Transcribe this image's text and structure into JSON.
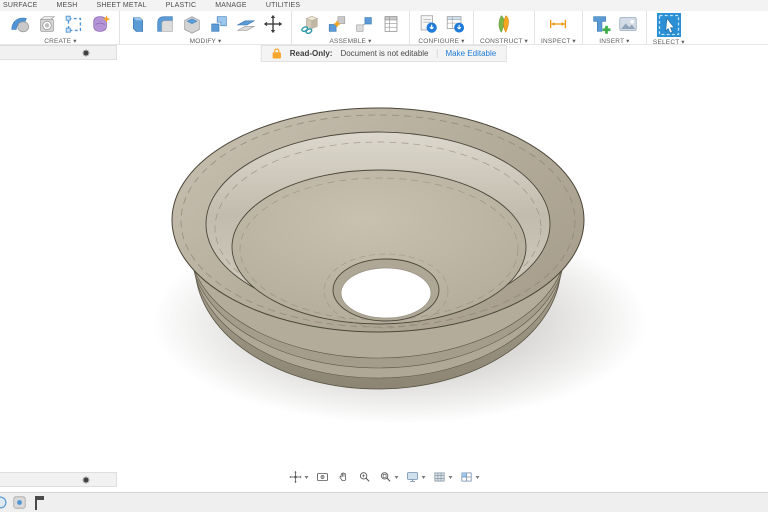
{
  "ribbon": {
    "tabs": [
      "SURFACE",
      "MESH",
      "SHEET METAL",
      "PLASTIC",
      "MANAGE",
      "UTILITIES"
    ],
    "groups": [
      {
        "label": "CREATE ▾",
        "icons": [
          "sweep-icon",
          "hole-face-icon",
          "sketch-icon",
          "form-icon"
        ]
      },
      {
        "label": "MODIFY ▾",
        "icons": [
          "press-pull-icon",
          "fillet-icon",
          "shell-icon",
          "combine-icon",
          "offset-face-icon",
          "move-icon"
        ]
      },
      {
        "label": "ASSEMBLE ▾",
        "icons": [
          "new-component-icon",
          "joint-icon",
          "as-built-joint-icon",
          "bom-table-icon"
        ]
      },
      {
        "label": "CONFIGURE ▾",
        "icons": [
          "configuration-icon",
          "configuration-table-icon"
        ]
      },
      {
        "label": "CONSTRUCT ▾",
        "icons": [
          "construction-plane-icon"
        ]
      },
      {
        "label": "INSPECT ▾",
        "icons": [
          "measure-icon"
        ]
      },
      {
        "label": "INSERT ▾",
        "icons": [
          "insert-derive-icon",
          "insert-image-icon"
        ]
      },
      {
        "label": "SELECT ▾",
        "icons": [
          "select-cursor-icon"
        ]
      }
    ]
  },
  "banner": {
    "title": "Read-Only:",
    "message": "Document is not editable",
    "action": "Make Editable",
    "lock_icon": "lock-icon",
    "colors": {
      "lock": "#f7a82a",
      "action_link": "#1e7bd7"
    }
  },
  "panels": {
    "top_collapsed_bar_icon": "gear-icon",
    "bottom_collapsed_bar_icon": "gear-icon"
  },
  "view_toolbar": {
    "items": [
      {
        "name": "orbit-icon",
        "dropdown": true
      },
      {
        "name": "look-at-icon",
        "dropdown": false
      },
      {
        "name": "pan-icon",
        "dropdown": false
      },
      {
        "name": "zoom-icon",
        "dropdown": false
      },
      {
        "name": "fit-icon",
        "dropdown": true
      },
      {
        "name": "display-settings-icon",
        "dropdown": true
      },
      {
        "name": "grid-settings-icon",
        "dropdown": true
      },
      {
        "name": "viewports-icon",
        "dropdown": true
      }
    ]
  },
  "timeline": {
    "items": [
      "timeline-options-icon",
      "timeline-capture-icon",
      "timeline-playhead"
    ]
  },
  "viewport": {
    "model": "flanged circular part with center hole",
    "colors": {
      "body": "#b7af9e",
      "body_light": "#d8d4c8",
      "body_dark": "#968e7d",
      "edge": "#4b463a",
      "shadow": "#c9c9c9",
      "background": "#ffffff"
    }
  }
}
